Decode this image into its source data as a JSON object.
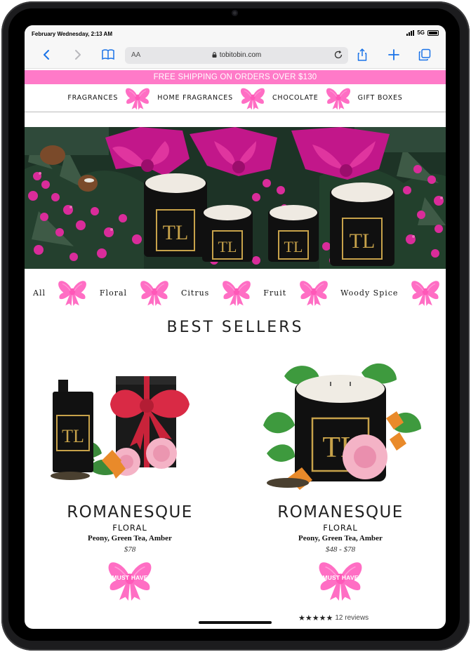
{
  "status": {
    "time": "February Wednesday, 2:13 AM",
    "network": "5G"
  },
  "browser": {
    "text_size": "AA",
    "url": "tobitobin.com"
  },
  "promo": {
    "text": "FREE SHIPPING ON ORDERS OVER $130"
  },
  "nav": {
    "items": [
      "FRAGRANCES",
      "HOME FRAGRANCES",
      "CHOCOLATE",
      "GIFT BOXES"
    ]
  },
  "filters": {
    "items": [
      "All",
      "Floral",
      "Citrus",
      "Fruit",
      "Woody Spice"
    ]
  },
  "section": {
    "title": "BEST SELLERS"
  },
  "products": [
    {
      "name": "ROMANESQUE",
      "category": "FLORAL",
      "notes": "Peony, Green Tea, Amber",
      "price": "$78",
      "badge": "MUST HAVE"
    },
    {
      "name": "ROMANESQUE",
      "category": "FLORAL",
      "notes": "Peony, Green Tea, Amber",
      "price": "$48 - $78",
      "badge": "MUST HAVE",
      "stars": 5,
      "reviews": "12 reviews"
    }
  ],
  "colors": {
    "brand_pink": "#ff7ac8",
    "link_blue": "#1a73e8"
  }
}
